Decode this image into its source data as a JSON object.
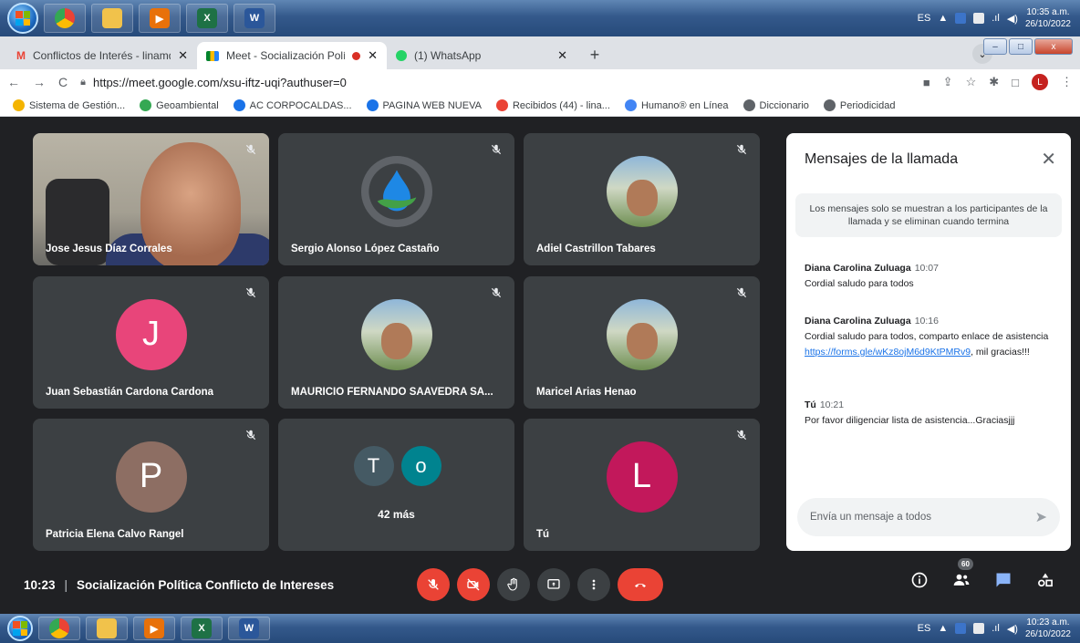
{
  "taskbar": {
    "lang": "ES",
    "clock_top": "10:35 a.m.",
    "date_top": "26/10/2022",
    "clock_bottom": "10:23 a.m.",
    "date_bottom": "26/10/2022",
    "apps": [
      "chrome-icon",
      "file-explorer-icon",
      "media-player-icon",
      "excel-icon",
      "word-icon"
    ]
  },
  "tabs": [
    {
      "title": "Conflictos de Interés - linamdaza",
      "favicon": "gmail-icon"
    },
    {
      "title": "Meet - Socialización Política",
      "favicon": "meet-icon"
    },
    {
      "title": "(1) WhatsApp",
      "favicon": "whatsapp-icon"
    }
  ],
  "window": {
    "minimize": "–",
    "maximize": "□",
    "close": "x"
  },
  "omnibox": {
    "url": "https://meet.google.com/xsu-iftz-uqi?authuser=0",
    "profile_initial": "L"
  },
  "bookmarks": [
    {
      "label": "Sistema de Gestión...",
      "color": "#f4b400"
    },
    {
      "label": "Geoambiental",
      "color": "#34a853"
    },
    {
      "label": "AC CORPOCALDAS...",
      "color": "#1a73e8"
    },
    {
      "label": "PAGINA WEB NUEVA",
      "color": "#1a73e8"
    },
    {
      "label": "Recibidos (44) - lina...",
      "color": "#ea4335"
    },
    {
      "label": "Humano® en Línea",
      "color": "#4285f4"
    },
    {
      "label": "Diccionario",
      "color": "#5f6368"
    },
    {
      "label": "Periodicidad",
      "color": "#5f6368"
    }
  ],
  "participants": [
    {
      "name": "Jose Jesus Díaz Corrales",
      "kind": "video"
    },
    {
      "name": "Sergio Alonso López Castaño",
      "kind": "logo"
    },
    {
      "name": "Adiel Castrillon Tabares",
      "kind": "photo"
    },
    {
      "name": "Juan Sebastián Cardona Cardona",
      "kind": "initial",
      "initial": "J",
      "color": "#e8457a"
    },
    {
      "name": "MAURICIO FERNANDO SAAVEDRA SA...",
      "kind": "photo"
    },
    {
      "name": "Maricel Arias Henao",
      "kind": "photo"
    },
    {
      "name": "Patricia Elena Calvo Rangel",
      "kind": "initial",
      "initial": "P",
      "color": "#8d6e63"
    },
    {
      "name": "",
      "kind": "others",
      "initials": [
        "T",
        "o"
      ],
      "colors": [
        "#455a64",
        "#00838f"
      ],
      "more": "42 más"
    },
    {
      "name": "Tú",
      "kind": "initial",
      "initial": "L",
      "color": "#c2185b"
    }
  ],
  "chat": {
    "title": "Mensajes de la llamada",
    "notice": "Los mensajes solo se muestran a los participantes de la llamada y se eliminan cuando termina",
    "messages": [
      {
        "author": "Diana Carolina Zuluaga",
        "time": "10:07",
        "text": "Cordial saludo para todos"
      },
      {
        "author": "Diana Carolina Zuluaga",
        "time": "10:16",
        "text_before": "Cordial saludo para todos, comparto enlace de asistencia ",
        "link": "https://forms.gle/wKz8ojM6d9KtPMRv9",
        "text_after": ", mil gracias!!!"
      },
      {
        "author": "Tú",
        "time": "10:21",
        "text": "Por favor diligenciar lista de asistencia...Graciasjjj"
      }
    ],
    "input_placeholder": "Envía un mensaje a todos"
  },
  "meeting": {
    "time": "10:23",
    "separator": "|",
    "title": "Socialización Política Conflicto de Intereses",
    "people_count": "60"
  }
}
